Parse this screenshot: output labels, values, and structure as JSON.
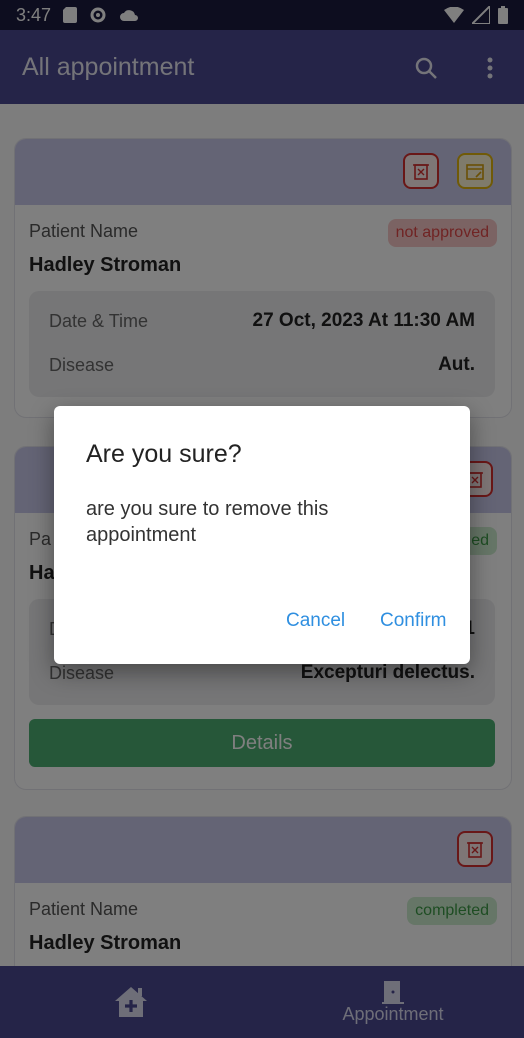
{
  "status_bar": {
    "time": "3:47"
  },
  "app_bar": {
    "title": "All appointment"
  },
  "cards": [
    {
      "patient_label": "Patient Name",
      "patient_name": "Hadley Stroman",
      "status": "not approved",
      "datetime_label": "Date & Time",
      "datetime_value": "27 Oct, 2023 At 11:30 AM",
      "disease_label": "Disease",
      "disease_value": "Aut."
    },
    {
      "patient_label": "Pa",
      "patient_name": "Ha",
      "status": "ed",
      "datetime_label": "D",
      "datetime_value": "1",
      "disease_label": "Disease",
      "disease_value": "Excepturi delectus.",
      "details_label": "Details"
    },
    {
      "patient_label": "Patient Name",
      "patient_name": "Hadley Stroman",
      "status": "completed"
    }
  ],
  "dialog": {
    "title": "Are you sure?",
    "message": "are you sure to remove this appointment",
    "cancel": "Cancel",
    "confirm": "Confirm"
  },
  "bottom_nav": {
    "home_icon": "home-plus-icon",
    "appointment_label": "Appointment",
    "appointment_icon": "door-icon"
  },
  "colors": {
    "primary": "#4b4891",
    "card_header": "#c9c8ea",
    "delete": "#d32f2f",
    "calendar": "#e0b40f",
    "accent_button": "#4caf72",
    "link": "#2f8fe0"
  }
}
